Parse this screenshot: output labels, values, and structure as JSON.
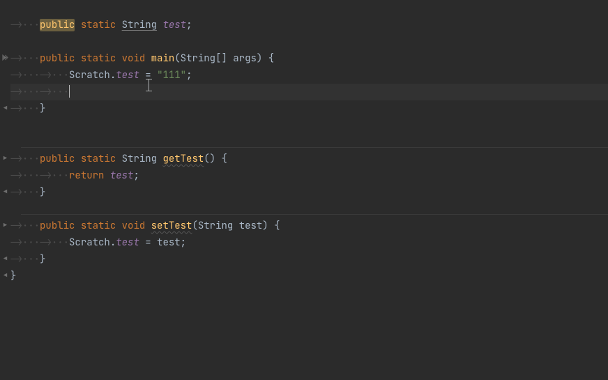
{
  "indent_arrow": "⟶",
  "ws_guide": "····",
  "code": {
    "l1": {
      "public": "public",
      "static": "static",
      "String": "String",
      "test": "test",
      "semi": ";"
    },
    "l2": "",
    "l3": {
      "public": "public",
      "static": "static",
      "void": "void",
      "main": "main",
      "params": "(String[] args) {",
      "String": "String",
      "args": "args"
    },
    "l4": {
      "scratch": "Scratch",
      "dot": ".",
      "test": "test",
      "eq": " = ",
      "val": "\"111\"",
      "semi": ";"
    },
    "l5": "",
    "l6": {
      "brace": "}"
    },
    "l7": "",
    "l8": "",
    "l9": {
      "public": "public",
      "static": "static",
      "String": "String",
      "getTest": "getTest",
      "rest": "() {"
    },
    "l10": {
      "return": "return",
      "test": "test",
      "semi": ";"
    },
    "l11": {
      "brace": "}"
    },
    "l12": "",
    "l13": {
      "public": "public",
      "static": "static",
      "void": "void",
      "setTest": "setTest",
      "open": "(",
      "String": "String",
      "test": "test",
      "close": ") {"
    },
    "l14": {
      "scratch": "Scratch",
      "dot": ".",
      "test": "test",
      "eq": " = test",
      "semi": ";"
    },
    "l15": {
      "brace": "}"
    },
    "l16": {
      "brace": "}"
    }
  },
  "gutter": {
    "fold_open": "fold-open-icon",
    "fold_close": "fold-close-icon"
  },
  "separators": [
    192,
    288
  ]
}
